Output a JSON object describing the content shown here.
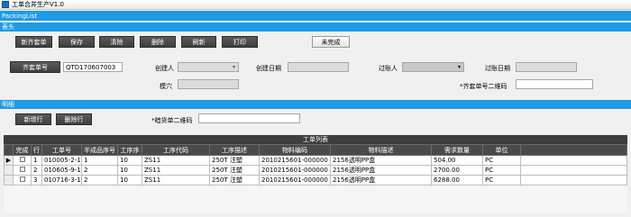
{
  "window": {
    "title": "工单合并生产V1.0"
  },
  "sections": {
    "packing": "PackingList",
    "header": "表头",
    "detail": "明细"
  },
  "toolbar": {
    "new_label": "新齐套单",
    "save_label": "保存",
    "clear_label": "清除",
    "delete_label": "删除",
    "refresh_label": "刷新",
    "print_label": "打印",
    "status_label": "未完成"
  },
  "form": {
    "kit_no_btn": "齐套单号",
    "kit_no_value": "QTD170607003",
    "creator_label": "创建人",
    "creator_value": "",
    "create_date_label": "创建日期",
    "create_date_value": "",
    "transfer_person_label": "过账人",
    "transfer_person_value": "",
    "transfer_date_label": "过账日期",
    "transfer_date_value": "",
    "cavity_label": "模穴",
    "cavity_value": "",
    "kit_qr_label": "*齐套单号二维码",
    "kit_qr_value": ""
  },
  "detail": {
    "add_row_label": "新增行",
    "delete_row_label": "删除行",
    "shelf_qr_label": "*暗货单二维码",
    "shelf_qr_value": ""
  },
  "grid": {
    "caption": "工单列表",
    "columns": [
      "完成",
      "行",
      "工单号",
      "半成品序号",
      "工序序",
      "工序代码",
      "工序描述",
      "物料编码",
      "物料描述",
      "需求数量",
      "单位"
    ],
    "rows": [
      {
        "marker": "▶",
        "done": "",
        "line": "1",
        "order": "010005-2-1",
        "semi": "1",
        "seq": "10",
        "code": "ZS11",
        "op_desc": "250T 注塑",
        "mat_code": "2010215601-000000",
        "mat_desc": "2156透明PP盒",
        "qty": "504.00",
        "unit": "PC"
      },
      {
        "marker": "",
        "done": "",
        "line": "2",
        "order": "010605-9-1",
        "semi": "2",
        "seq": "10",
        "code": "ZS11",
        "op_desc": "250T 注塑",
        "mat_code": "2010215601-000000",
        "mat_desc": "2156透明PP盒",
        "qty": "2700.00",
        "unit": "PC"
      },
      {
        "marker": "",
        "done": "",
        "line": "3",
        "order": "010716-3-1",
        "semi": "2",
        "seq": "10",
        "code": "ZS11",
        "op_desc": "250T 注塑",
        "mat_code": "2010215601-000000",
        "mat_desc": "2156透明PP盒",
        "qty": "6288.00",
        "unit": "PC"
      }
    ]
  },
  "colors": {
    "section_bar": "#1e9be3",
    "button_dark": "#4a4a4a",
    "grid_header": "#4a4a4a"
  }
}
